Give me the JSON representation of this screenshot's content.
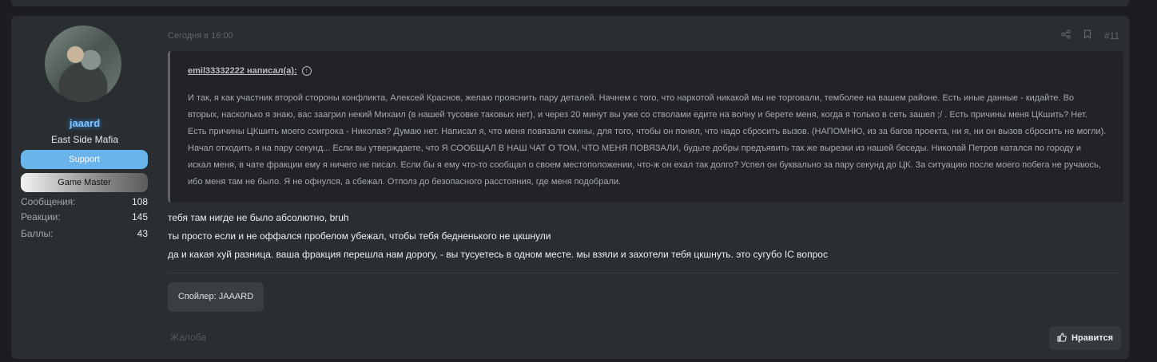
{
  "post": {
    "date": "Сегодня в 16:00",
    "number": "#11",
    "user": {
      "name": "jaaard",
      "title": "East Side Mafia",
      "banners": [
        "Support",
        "Game Master"
      ],
      "stats": [
        {
          "label": "Сообщения:",
          "value": "108"
        },
        {
          "label": "Реакции:",
          "value": "145"
        },
        {
          "label": "Баллы:",
          "value": "43"
        }
      ]
    },
    "quote": {
      "author": "emil33332222 написал(а):",
      "text": "И так, я как участник второй стороны конфликта, Алексей Краснов, желаю прояснить пару деталей. Начнем с того, что наркотой никакой мы не торговали, темболее на вашем районе. Есть иные данные - кидайте. Во вторых, насколько я знаю, вас заагрил некий Михаил (в нашей тусовке таковых нет), и через 20 минут вы уже со стволами едите на волну и берете меня, когда я только в сеть зашел ;/ . Есть причины меня ЦКшить? Нет. Есть причины ЦКшить моего соигрока - Николая? Думаю нет. Написал я, что меня повязали скины, для того, чтобы он понял, что надо сбросить вызов. (НАПОМНЮ, из за багов проекта, ни я, ни он вызов сбросить не могли). Начал отходить я на пару секунд... Если вы утверждаете, что Я СООБЩАЛ В НАШ ЧАТ О ТОМ, ЧТО МЕНЯ ПОВЯЗАЛИ, будьте добры предъявить так же вырезки из нашей беседы. Николай Петров катался по городу и искал меня, в чате фракции ему я ничего не писал. Если бы я ему что-то сообщал о своем местоположении, что-ж он ехал так долго? Успел он буквально за пару секунд до ЦК. За ситуацию после моего побега не ручаюсь, ибо меня там не было. Я не офнулся, а сбежал. Отполз до безопасного расстояния, где меня подобрали."
    },
    "messages": [
      "тебя там нигде не было абсолютно, bruh",
      "ты просто если и не оффался пробелом убежал, чтобы тебя бедненького не цкшнули",
      "да и какая хуй разница. ваша фракция перешла нам дорогу, - вы тусуетесь в одном месте. мы взяли и захотели тебя цкшнуть. это сугубо IC вопрос"
    ],
    "spoiler_label": "Спойлер: JAAARD",
    "report_label": "Жалоба",
    "like_label": "Нравится"
  }
}
